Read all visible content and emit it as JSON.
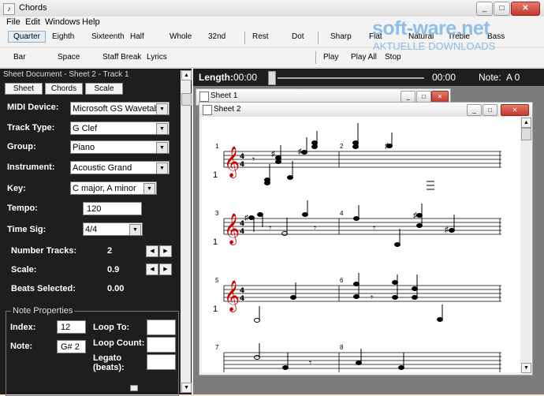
{
  "window": {
    "title": "Chords",
    "controls": {
      "minimize": "_",
      "maximize": "□",
      "close": "✕"
    }
  },
  "watermark": {
    "brand": "soft-ware.net",
    "tagline": "AKTUELLE DOWNLOADS",
    "color": "#7fb5e6"
  },
  "menu": {
    "items": [
      "File",
      "Edit",
      "Windows",
      "Help"
    ]
  },
  "toolbar": {
    "row1": [
      "Quarter",
      "Eighth",
      "Sixteenth",
      "Half",
      "Whole",
      "32nd",
      "Rest",
      "Dot",
      "Sharp",
      "Flat",
      "Natural",
      "Treble",
      "Bass"
    ],
    "row1_selected": "Quarter",
    "row2": [
      "Bar",
      "Space",
      "Staff Break",
      "Lyrics",
      "Play",
      "Play All",
      "Stop"
    ]
  },
  "document": {
    "header": "Sheet Document - Sheet 2 - Track 1",
    "tabs": [
      "Sheet",
      "Chords",
      "Scale"
    ]
  },
  "properties": {
    "midi_device": {
      "label": "MIDI Device:",
      "value": "Microsoft GS Wavetable"
    },
    "track_type": {
      "label": "Track Type:",
      "value": "G Clef"
    },
    "group": {
      "label": "Group:",
      "value": "Piano"
    },
    "instrument": {
      "label": "Instrument:",
      "value": "Acoustic Grand"
    },
    "key": {
      "label": "Key:",
      "value": "C major, A minor"
    },
    "tempo": {
      "label": "Tempo:",
      "value": "120"
    },
    "time_sig": {
      "label": "Time Sig:",
      "value": "4/4"
    },
    "number_tracks": {
      "label": "Number Tracks:",
      "value": "2"
    },
    "scale": {
      "label": "Scale:",
      "value": "0.9"
    },
    "beats_selected": {
      "label": "Beats Selected:",
      "value": "0.00"
    }
  },
  "note_properties": {
    "legend": "Note Properties",
    "index": {
      "label": "Index:",
      "value": "12"
    },
    "note": {
      "label": "Note:",
      "value": "G# 2"
    },
    "loop_to": {
      "label": "Loop To:",
      "value": ""
    },
    "loop_count": {
      "label": "Loop Count:",
      "value": ""
    },
    "legato": {
      "label_line1": "Legato",
      "label_line2": "(beats):",
      "value": ""
    }
  },
  "transport": {
    "length_label": "Length:",
    "length_value": "00:00",
    "position_value": "00:00",
    "note_label": "Note:",
    "note_value": "A 0",
    "position_fraction": 0
  },
  "sheets": {
    "sheet1_title": "Sheet 1",
    "sheet2_title": "Sheet 2",
    "measure_numbers": [
      "1",
      "2",
      "3",
      "4",
      "5",
      "6",
      "7",
      "8"
    ],
    "staff_numbers": [
      "1",
      "1",
      "1"
    ],
    "clef_glyph": "𝄞",
    "time_sig_top": "4",
    "time_sig_bottom": "4",
    "accent_color": "#cc0000"
  }
}
